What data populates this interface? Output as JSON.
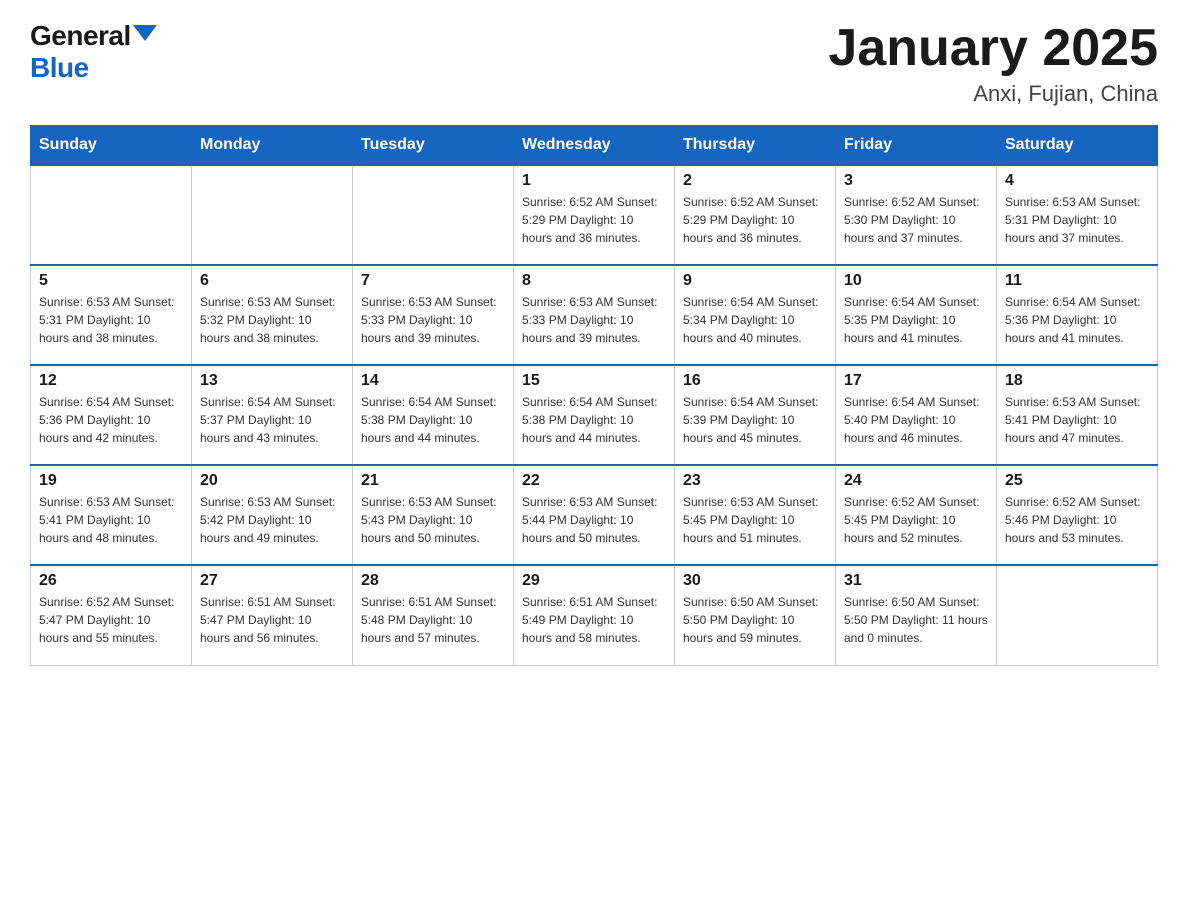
{
  "logo": {
    "general": "General",
    "blue": "Blue"
  },
  "title": "January 2025",
  "location": "Anxi, Fujian, China",
  "days_of_week": [
    "Sunday",
    "Monday",
    "Tuesday",
    "Wednesday",
    "Thursday",
    "Friday",
    "Saturday"
  ],
  "weeks": [
    [
      {
        "day": "",
        "info": ""
      },
      {
        "day": "",
        "info": ""
      },
      {
        "day": "",
        "info": ""
      },
      {
        "day": "1",
        "info": "Sunrise: 6:52 AM\nSunset: 5:29 PM\nDaylight: 10 hours\nand 36 minutes."
      },
      {
        "day": "2",
        "info": "Sunrise: 6:52 AM\nSunset: 5:29 PM\nDaylight: 10 hours\nand 36 minutes."
      },
      {
        "day": "3",
        "info": "Sunrise: 6:52 AM\nSunset: 5:30 PM\nDaylight: 10 hours\nand 37 minutes."
      },
      {
        "day": "4",
        "info": "Sunrise: 6:53 AM\nSunset: 5:31 PM\nDaylight: 10 hours\nand 37 minutes."
      }
    ],
    [
      {
        "day": "5",
        "info": "Sunrise: 6:53 AM\nSunset: 5:31 PM\nDaylight: 10 hours\nand 38 minutes."
      },
      {
        "day": "6",
        "info": "Sunrise: 6:53 AM\nSunset: 5:32 PM\nDaylight: 10 hours\nand 38 minutes."
      },
      {
        "day": "7",
        "info": "Sunrise: 6:53 AM\nSunset: 5:33 PM\nDaylight: 10 hours\nand 39 minutes."
      },
      {
        "day": "8",
        "info": "Sunrise: 6:53 AM\nSunset: 5:33 PM\nDaylight: 10 hours\nand 39 minutes."
      },
      {
        "day": "9",
        "info": "Sunrise: 6:54 AM\nSunset: 5:34 PM\nDaylight: 10 hours\nand 40 minutes."
      },
      {
        "day": "10",
        "info": "Sunrise: 6:54 AM\nSunset: 5:35 PM\nDaylight: 10 hours\nand 41 minutes."
      },
      {
        "day": "11",
        "info": "Sunrise: 6:54 AM\nSunset: 5:36 PM\nDaylight: 10 hours\nand 41 minutes."
      }
    ],
    [
      {
        "day": "12",
        "info": "Sunrise: 6:54 AM\nSunset: 5:36 PM\nDaylight: 10 hours\nand 42 minutes."
      },
      {
        "day": "13",
        "info": "Sunrise: 6:54 AM\nSunset: 5:37 PM\nDaylight: 10 hours\nand 43 minutes."
      },
      {
        "day": "14",
        "info": "Sunrise: 6:54 AM\nSunset: 5:38 PM\nDaylight: 10 hours\nand 44 minutes."
      },
      {
        "day": "15",
        "info": "Sunrise: 6:54 AM\nSunset: 5:38 PM\nDaylight: 10 hours\nand 44 minutes."
      },
      {
        "day": "16",
        "info": "Sunrise: 6:54 AM\nSunset: 5:39 PM\nDaylight: 10 hours\nand 45 minutes."
      },
      {
        "day": "17",
        "info": "Sunrise: 6:54 AM\nSunset: 5:40 PM\nDaylight: 10 hours\nand 46 minutes."
      },
      {
        "day": "18",
        "info": "Sunrise: 6:53 AM\nSunset: 5:41 PM\nDaylight: 10 hours\nand 47 minutes."
      }
    ],
    [
      {
        "day": "19",
        "info": "Sunrise: 6:53 AM\nSunset: 5:41 PM\nDaylight: 10 hours\nand 48 minutes."
      },
      {
        "day": "20",
        "info": "Sunrise: 6:53 AM\nSunset: 5:42 PM\nDaylight: 10 hours\nand 49 minutes."
      },
      {
        "day": "21",
        "info": "Sunrise: 6:53 AM\nSunset: 5:43 PM\nDaylight: 10 hours\nand 50 minutes."
      },
      {
        "day": "22",
        "info": "Sunrise: 6:53 AM\nSunset: 5:44 PM\nDaylight: 10 hours\nand 50 minutes."
      },
      {
        "day": "23",
        "info": "Sunrise: 6:53 AM\nSunset: 5:45 PM\nDaylight: 10 hours\nand 51 minutes."
      },
      {
        "day": "24",
        "info": "Sunrise: 6:52 AM\nSunset: 5:45 PM\nDaylight: 10 hours\nand 52 minutes."
      },
      {
        "day": "25",
        "info": "Sunrise: 6:52 AM\nSunset: 5:46 PM\nDaylight: 10 hours\nand 53 minutes."
      }
    ],
    [
      {
        "day": "26",
        "info": "Sunrise: 6:52 AM\nSunset: 5:47 PM\nDaylight: 10 hours\nand 55 minutes."
      },
      {
        "day": "27",
        "info": "Sunrise: 6:51 AM\nSunset: 5:47 PM\nDaylight: 10 hours\nand 56 minutes."
      },
      {
        "day": "28",
        "info": "Sunrise: 6:51 AM\nSunset: 5:48 PM\nDaylight: 10 hours\nand 57 minutes."
      },
      {
        "day": "29",
        "info": "Sunrise: 6:51 AM\nSunset: 5:49 PM\nDaylight: 10 hours\nand 58 minutes."
      },
      {
        "day": "30",
        "info": "Sunrise: 6:50 AM\nSunset: 5:50 PM\nDaylight: 10 hours\nand 59 minutes."
      },
      {
        "day": "31",
        "info": "Sunrise: 6:50 AM\nSunset: 5:50 PM\nDaylight: 11 hours\nand 0 minutes."
      },
      {
        "day": "",
        "info": ""
      }
    ]
  ]
}
